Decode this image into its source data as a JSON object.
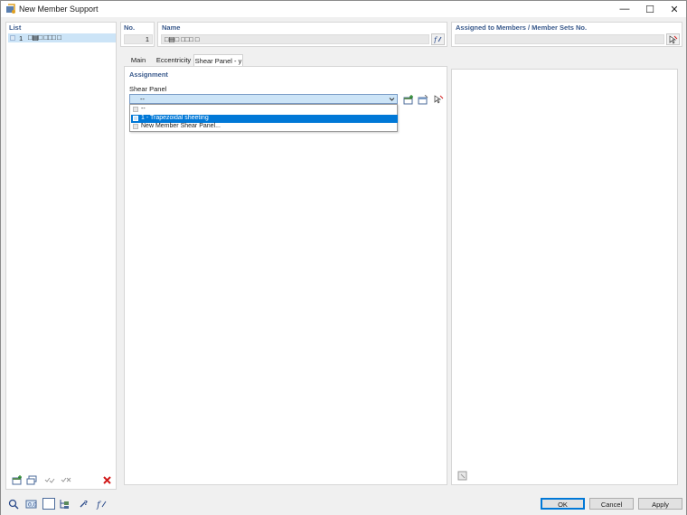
{
  "window": {
    "title": "New Member Support",
    "controls": {
      "minimize": "—",
      "maximize": "☐",
      "close": "✕"
    }
  },
  "list": {
    "label": "List",
    "items": [
      {
        "number": "1",
        "name": "□▤□ □□□ □"
      }
    ]
  },
  "header": {
    "no_label": "No.",
    "no_value": "1",
    "name_label": "Name",
    "name_value": "□▤□ □□□ □",
    "assigned_label": "Assigned to Members / Member Sets No.",
    "assigned_value": ""
  },
  "tabs": [
    {
      "label": "Main",
      "active": false
    },
    {
      "label": "Eccentricity",
      "active": false
    },
    {
      "label": "Shear Panel - y",
      "active": true
    }
  ],
  "assignment": {
    "section_label": "Assignment",
    "shear_panel_label": "Shear Panel",
    "combo_value": "--",
    "dropdown_options": [
      {
        "label": "--",
        "selected": false
      },
      {
        "label": "1 - Trapezoidal sheeting",
        "selected": true
      },
      {
        "label": "New Member Shear Panel...",
        "selected": false
      }
    ]
  },
  "buttons": {
    "ok": "OK",
    "cancel": "Cancel",
    "apply": "Apply"
  },
  "colors": {
    "accent": "#0078d7",
    "selection_bg": "#cce4f7",
    "label_blue": "#3a5a8c",
    "delete_red": "#d11a1a"
  }
}
